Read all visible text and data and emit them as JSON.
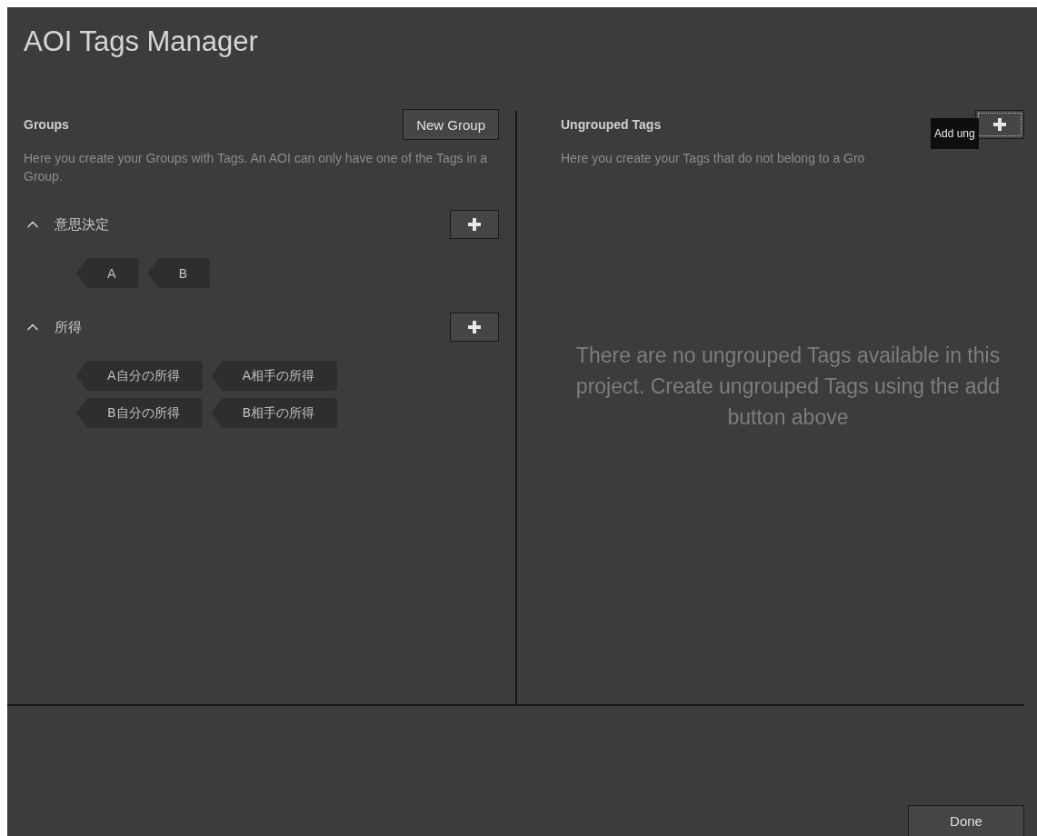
{
  "window": {
    "title": "AOI Tags Manager"
  },
  "groups_panel": {
    "heading": "Groups",
    "new_button": "New Group",
    "description": "Here you create your Groups with Tags. An AOI can only have one of the Tags in a Group.",
    "groups": [
      {
        "name": "意思決定",
        "expanded": true,
        "tags": [
          "A",
          "B"
        ]
      },
      {
        "name": "所得",
        "expanded": true,
        "tags": [
          "A自分の所得",
          "A相手の所得",
          "B自分の所得",
          "B相手の所得"
        ]
      }
    ]
  },
  "ungrouped_panel": {
    "heading": "Ungrouped Tags",
    "description": "Here you create your Tags that do not belong to a Gro",
    "tooltip": "Add ung",
    "empty_message": "There are no ungrouped Tags available in this project. Create ungrouped Tags using the add button above"
  },
  "buttons": [
    "Done"
  ]
}
